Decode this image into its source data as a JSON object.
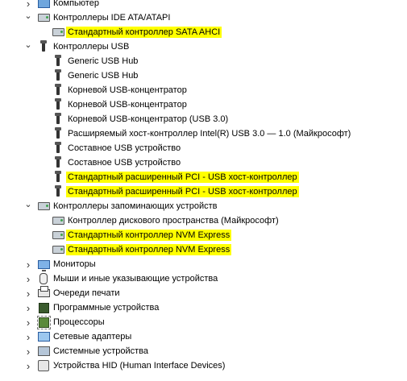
{
  "tree": [
    {
      "label": "Компьютер",
      "level": 0,
      "expanded": false,
      "icon": "computer-icon",
      "highlight": false
    },
    {
      "label": "Контроллеры IDE ATA/ATAPI",
      "level": 0,
      "expanded": true,
      "icon": "ide-controller-icon",
      "highlight": false
    },
    {
      "label": "Стандартный контроллер SATA AHCI",
      "level": 1,
      "icon": "ide-controller-icon",
      "highlight": true
    },
    {
      "label": "Контроллеры USB",
      "level": 0,
      "expanded": true,
      "icon": "usb-icon",
      "highlight": false
    },
    {
      "label": "Generic USB Hub",
      "level": 1,
      "icon": "usb-icon",
      "highlight": false
    },
    {
      "label": "Generic USB Hub",
      "level": 1,
      "icon": "usb-icon",
      "highlight": false
    },
    {
      "label": "Корневой USB-концентратор",
      "level": 1,
      "icon": "usb-icon",
      "highlight": false
    },
    {
      "label": "Корневой USB-концентратор",
      "level": 1,
      "icon": "usb-icon",
      "highlight": false
    },
    {
      "label": "Корневой USB-концентратор (USB 3.0)",
      "level": 1,
      "icon": "usb-icon",
      "highlight": false
    },
    {
      "label": "Расширяемый хост-контроллер Intel(R) USB 3.0 — 1.0 (Майкрософт)",
      "level": 1,
      "icon": "usb-icon",
      "highlight": false
    },
    {
      "label": "Составное USB устройство",
      "level": 1,
      "icon": "usb-icon",
      "highlight": false
    },
    {
      "label": "Составное USB устройство",
      "level": 1,
      "icon": "usb-icon",
      "highlight": false
    },
    {
      "label": "Стандартный расширенный PCI - USB хост-контроллер",
      "level": 1,
      "icon": "usb-icon",
      "highlight": true
    },
    {
      "label": "Стандартный расширенный PCI - USB хост-контроллер",
      "level": 1,
      "icon": "usb-icon",
      "highlight": true
    },
    {
      "label": "Контроллеры запоминающих устройств",
      "level": 0,
      "expanded": true,
      "icon": "storage-controller-icon",
      "highlight": false
    },
    {
      "label": "Контроллер дискового пространства (Майкрософт)",
      "level": 1,
      "icon": "storage-controller-icon",
      "highlight": false
    },
    {
      "label": "Стандартный контроллер NVM Express",
      "level": 1,
      "icon": "storage-controller-icon",
      "highlight": true
    },
    {
      "label": "Стандартный контроллер NVM Express",
      "level": 1,
      "icon": "storage-controller-icon",
      "highlight": true
    },
    {
      "label": "Мониторы",
      "level": 0,
      "expanded": false,
      "icon": "monitor-icon",
      "highlight": false
    },
    {
      "label": "Мыши и иные указывающие устройства",
      "level": 0,
      "expanded": false,
      "icon": "mouse-icon",
      "highlight": false
    },
    {
      "label": "Очереди печати",
      "level": 0,
      "expanded": false,
      "icon": "printer-icon",
      "highlight": false
    },
    {
      "label": "Программные устройства",
      "level": 0,
      "expanded": false,
      "icon": "software-device-icon",
      "highlight": false
    },
    {
      "label": "Процессоры",
      "level": 0,
      "expanded": false,
      "icon": "processor-icon",
      "highlight": false
    },
    {
      "label": "Сетевые адаптеры",
      "level": 0,
      "expanded": false,
      "icon": "network-adapter-icon",
      "highlight": false
    },
    {
      "label": "Системные устройства",
      "level": 0,
      "expanded": false,
      "icon": "system-device-icon",
      "highlight": false
    },
    {
      "label": "Устройства HID (Human Interface Devices)",
      "level": 0,
      "expanded": false,
      "icon": "hid-icon",
      "highlight": false
    }
  ],
  "colors": {
    "highlight": "#ffff00"
  }
}
